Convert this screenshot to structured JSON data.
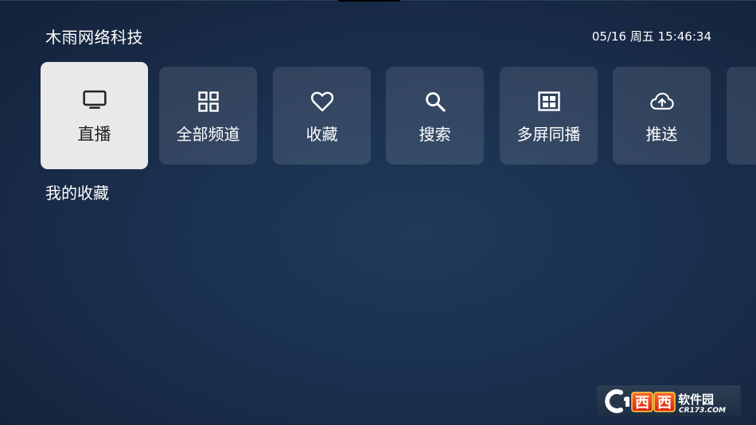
{
  "header": {
    "app_title": "木雨网络科技",
    "datetime": "05/16 周五 15:46:34"
  },
  "menu": {
    "items": [
      {
        "label": "直播",
        "icon": "tv-icon",
        "active": true
      },
      {
        "label": "全部频道",
        "icon": "grid-icon",
        "active": false
      },
      {
        "label": "收藏",
        "icon": "heart-icon",
        "active": false
      },
      {
        "label": "搜索",
        "icon": "search-icon",
        "active": false
      },
      {
        "label": "多屏同播",
        "icon": "multi-screen-icon",
        "active": false
      },
      {
        "label": "推送",
        "icon": "cloud-upload-icon",
        "active": false
      },
      {
        "label": "",
        "icon": "",
        "active": false
      }
    ]
  },
  "favorites": {
    "title": "我的收藏"
  },
  "watermark": {
    "brand": "西西软件园",
    "site": "CR173.COM"
  },
  "colors": {
    "background": "#1b3150",
    "tile": "rgba(255,255,255,0.11)",
    "active_tile": "#e9e9e9",
    "active_text": "#222222",
    "text": "#ffffff"
  }
}
